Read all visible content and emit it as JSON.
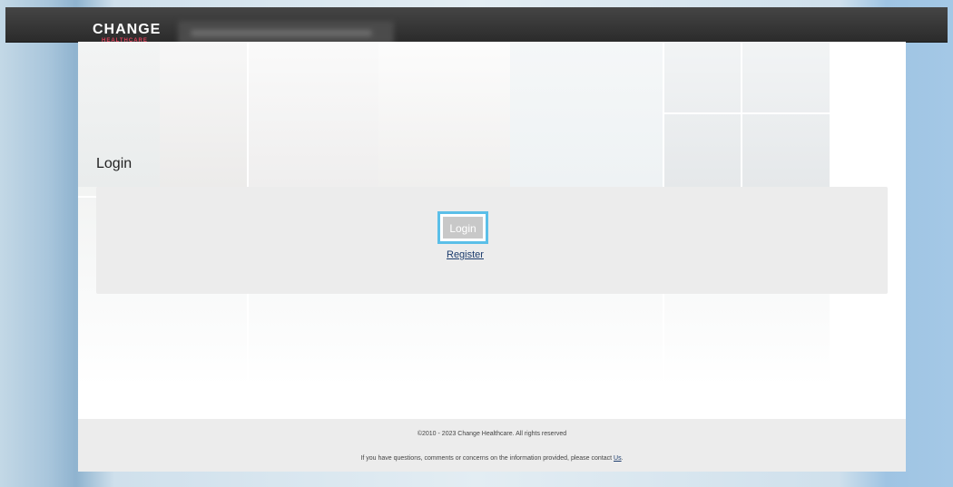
{
  "header": {
    "logo_word": "CHANGE",
    "logo_subtitle": "HEALTHCARE"
  },
  "main": {
    "heading": "Login",
    "login_button": "Login",
    "register_link": "Register"
  },
  "footer": {
    "copyright": "©2010 - 2023 Change Healthcare. All rights reserved",
    "contact_text": "If you have questions, comments or concerns on the information provided, please contact ",
    "contact_link": "Us",
    "contact_end": "."
  },
  "colors": {
    "topbar": "#333333",
    "accent_focus": "#5bbfe8",
    "brand_red": "#e0405a",
    "panel": "#ececec"
  }
}
